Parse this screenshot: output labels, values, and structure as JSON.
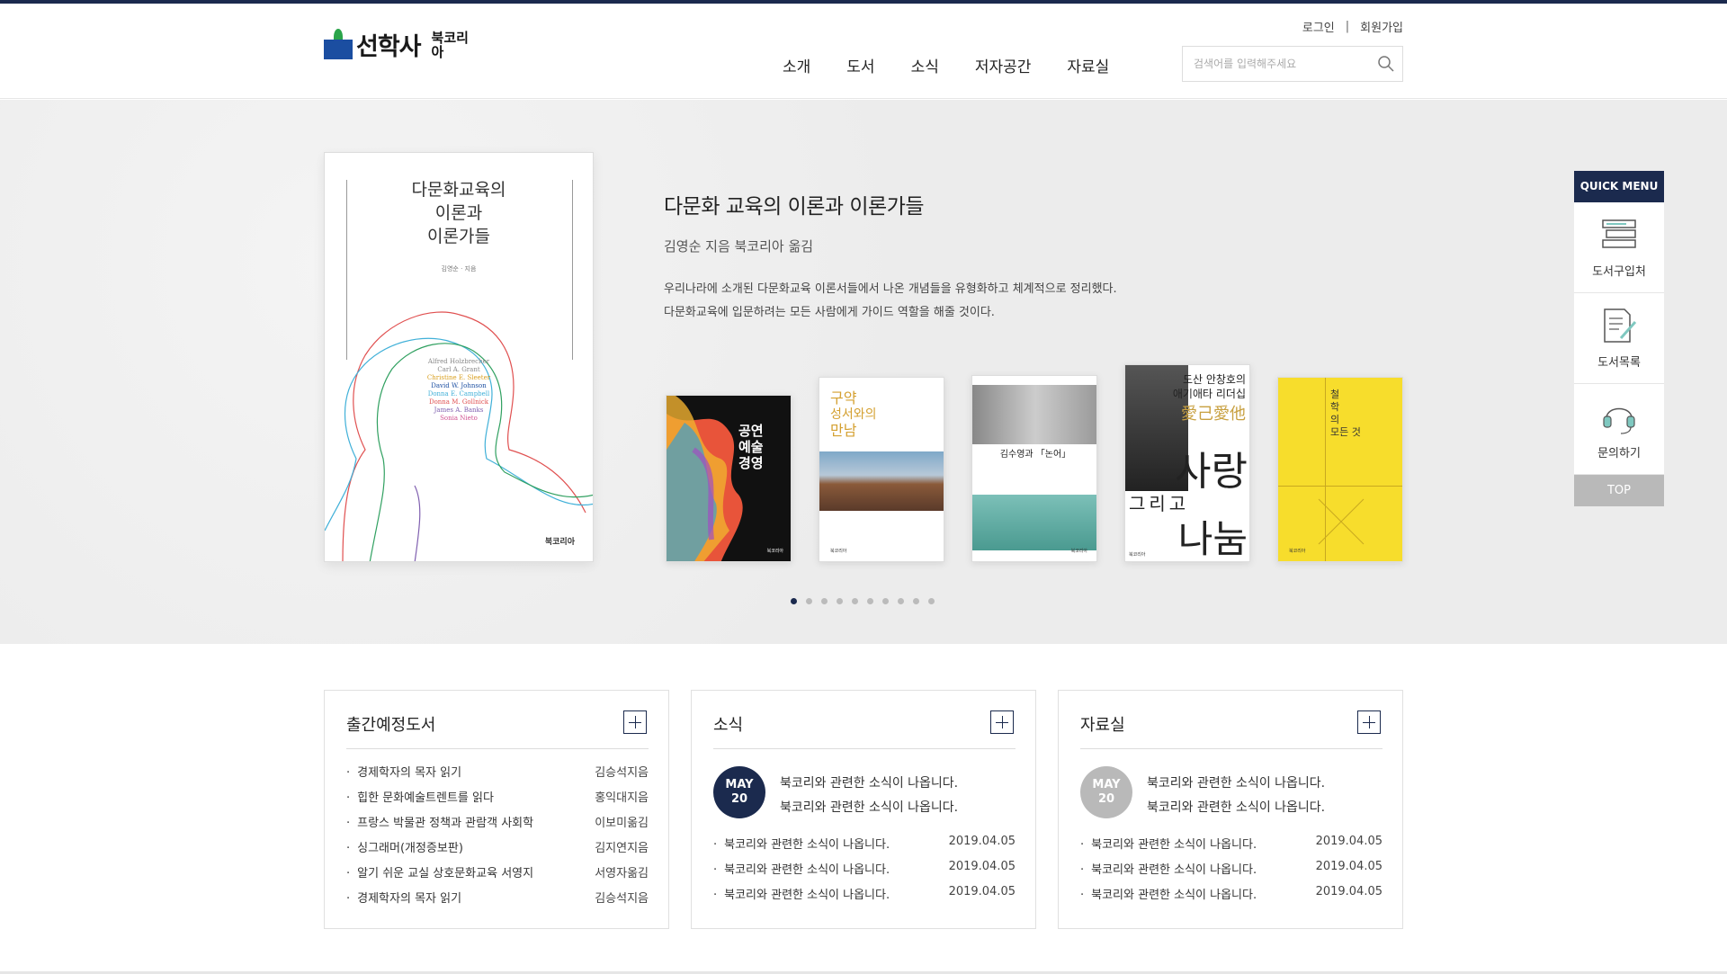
{
  "header": {
    "logo_text": "선학사",
    "logo_sub": "북코리아",
    "util": {
      "login": "로그인",
      "separator": "|",
      "signup": "회원가입"
    },
    "nav": [
      "소개",
      "도서",
      "소식",
      "저자공간",
      "자료실"
    ],
    "search": {
      "placeholder": "검색어를 입력해주세요"
    }
  },
  "hero": {
    "cover": {
      "title_lines": [
        "다문화교육의",
        "이론과",
        "이론가들"
      ],
      "author": "김영순 · 지음",
      "names": [
        "Alfred Holzbrecher",
        "Carl A. Grant",
        "Christine E. Sleeter",
        "David W. Johnson",
        "Donna E. Campbell",
        "Donna M. Gollnick",
        "James A. Banks",
        "Sonia Nieto"
      ],
      "publisher": "북코리아"
    },
    "title": "다문화 교육의 이론과 이론가들",
    "author_line": "김영순 지음   북코리아 옮김",
    "desc_lines": [
      "우리나라에 소개된 다문화교육 이론서들에서 나온 개념들을 유형화하고 체계적으로 정리했다.",
      "다문화교육에 입문하려는 모든 사람에게 가이드 역할을 해줄 것이다."
    ],
    "books": [
      {
        "title_lines": [
          "공연",
          "예술",
          "경영"
        ],
        "small": "북코리아"
      },
      {
        "title_lines": [
          "구약",
          "성서와의",
          "만남"
        ],
        "small": "북코리아"
      },
      {
        "title": "김수영과 「논어」",
        "small": "북코리아"
      },
      {
        "title_top": "도산 안창호의",
        "title_mid": "애기애타 리더십",
        "hanja": "愛己愛他",
        "big1": "사랑",
        "big2": "그리고",
        "big3": "나눔",
        "small": "북코리아"
      },
      {
        "title_lines": [
          "철",
          "학",
          "의",
          "모든 것"
        ],
        "small": "북코리아"
      }
    ],
    "dots_count": 10,
    "active_dot": 0
  },
  "quick_menu": {
    "heading": "QUICK MENU",
    "items": [
      {
        "label": "도서구입처",
        "icon": "books-icon"
      },
      {
        "label": "도서목록",
        "icon": "document-pen-icon"
      },
      {
        "label": "문의하기",
        "icon": "headset-icon"
      }
    ],
    "top": "TOP"
  },
  "boards": {
    "upcoming": {
      "title": "출간예정도서",
      "items": [
        {
          "title": "경제학자의 목자 읽기",
          "right": "김승석지음"
        },
        {
          "title": "힙한 문화예술트렌트를 읽다",
          "right": "홍익대지음"
        },
        {
          "title": "프랑스 박물관 정책과 관람객 사회학",
          "right": "이보미옮김"
        },
        {
          "title": "싱그래머(개정증보판)",
          "right": "김지연지음"
        },
        {
          "title": "알기 쉬운 교실 상호문화교육 서영지",
          "right": "서영자옮김"
        },
        {
          "title": "경제학자의 목자 읽기",
          "right": "김승석지음"
        }
      ]
    },
    "news": {
      "title": "소식",
      "date_month": "MAY",
      "date_day": "20",
      "feature_lines": [
        "북코리와 관련한 소식이 나옵니다.",
        "북코리와 관련한 소식이 나옵니다."
      ],
      "items": [
        {
          "title": "북코리와 관련한 소식이 나옵니다.",
          "right": "2019.04.05"
        },
        {
          "title": "북코리와 관련한 소식이 나옵니다.",
          "right": "2019.04.05"
        },
        {
          "title": "북코리와 관련한 소식이 나옵니다.",
          "right": "2019.04.05"
        }
      ]
    },
    "archive": {
      "title": "자료실",
      "date_month": "MAY",
      "date_day": "20",
      "feature_lines": [
        "북코리와 관련한 소식이 나옵니다.",
        "북코리와 관련한 소식이 나옵니다."
      ],
      "items": [
        {
          "title": "북코리와 관련한 소식이 나옵니다.",
          "right": "2019.04.05"
        },
        {
          "title": "북코리와 관련한 소식이 나옵니다.",
          "right": "2019.04.05"
        },
        {
          "title": "북코리와 관련한 소식이 나옵니다.",
          "right": "2019.04.05"
        }
      ]
    }
  },
  "colors": {
    "navy": "#1b2a4e",
    "gray": "#b9b9b9",
    "yellow": "#f7dd2c",
    "logo_blue": "#1b4ea1",
    "logo_green": "#2aa44a"
  }
}
